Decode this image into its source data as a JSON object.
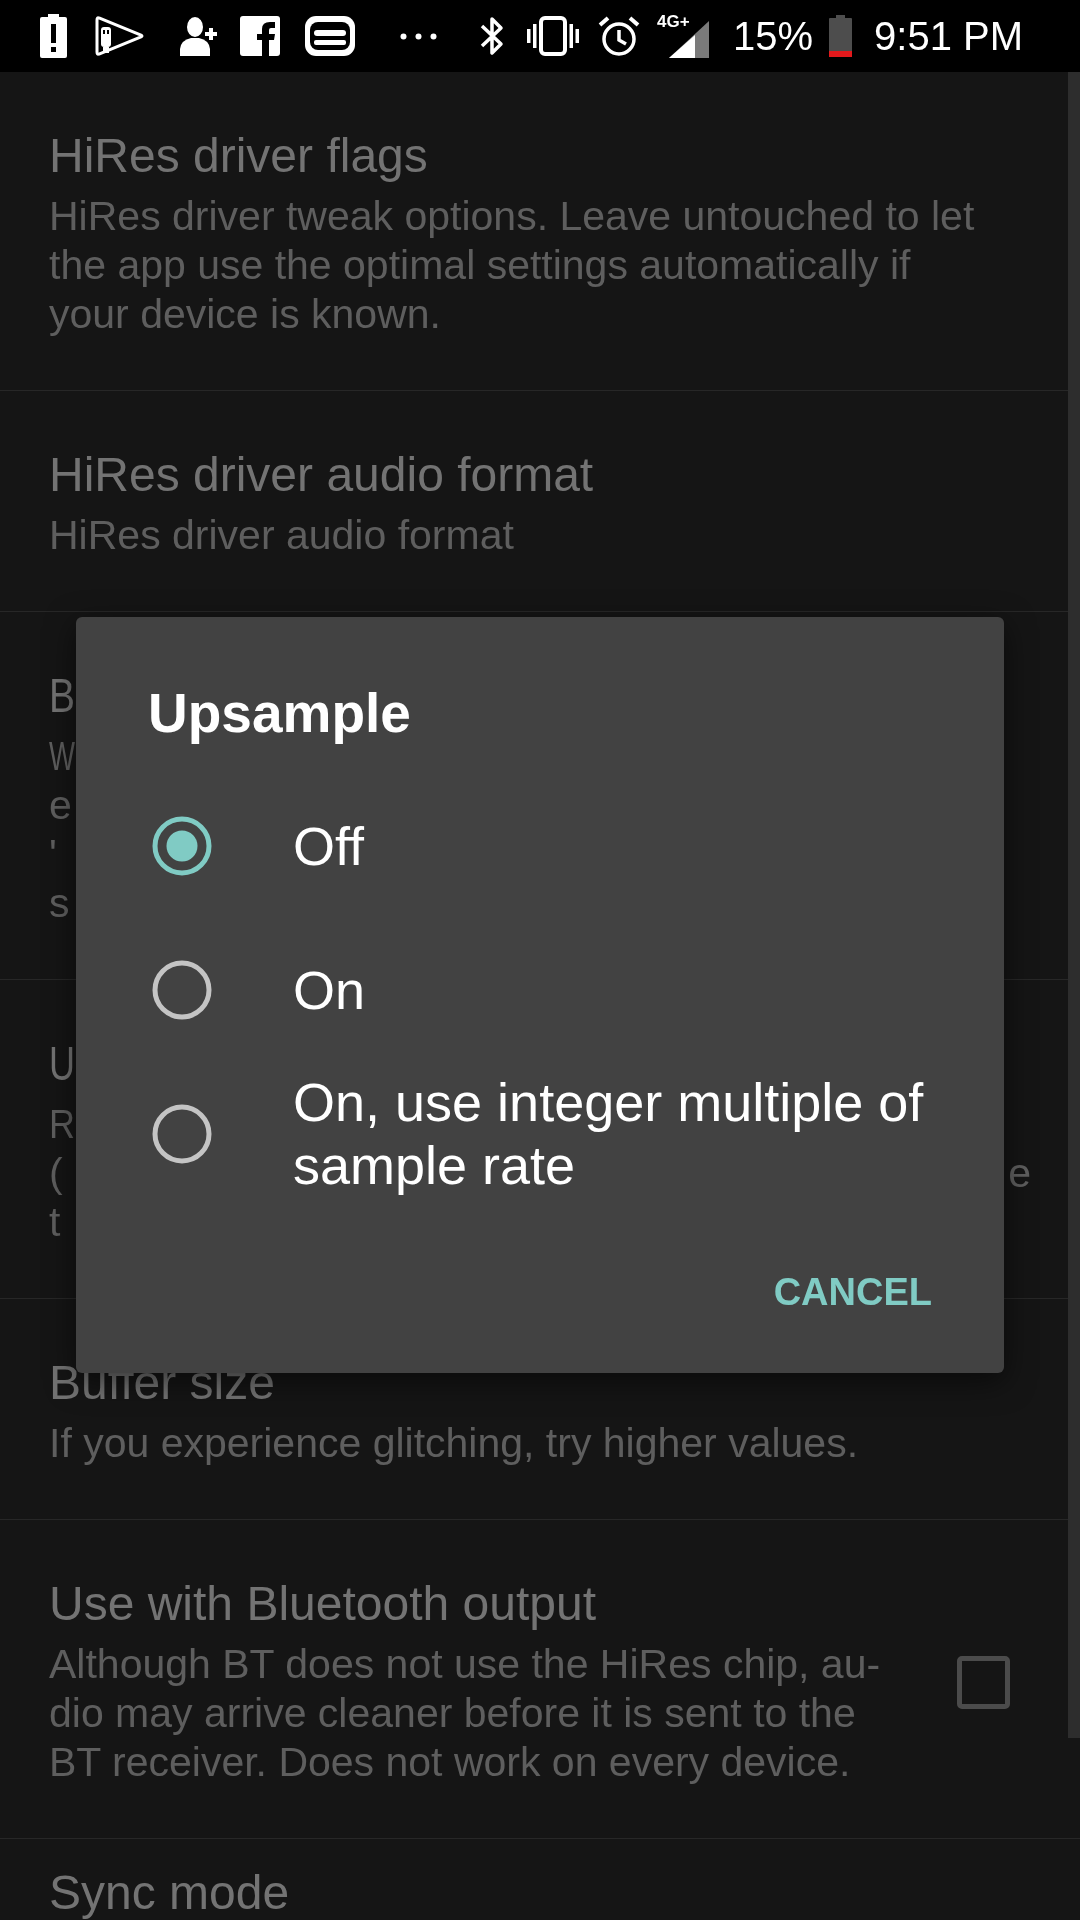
{
  "status_bar": {
    "network_type": "4G+",
    "battery_percent": "15%",
    "time": "9:51 PM"
  },
  "settings": [
    {
      "kind": "text",
      "title": "HiRes driver flags",
      "summary": "HiRes driver tweak options. Leave untouched to let\nthe app use the optimal settings automatically if\nyour device is known."
    },
    {
      "kind": "text",
      "title": "HiRes driver audio format",
      "summary": "HiRes driver audio format"
    },
    {
      "kind": "covered",
      "title": "B",
      "summary_lines": [
        {
          "start": "W"
        },
        {
          "start": "e"
        },
        {
          "start": "'"
        },
        {
          "start": "s"
        }
      ]
    },
    {
      "kind": "covered",
      "title": "U",
      "summary_lines": [
        {
          "start": "R"
        },
        {
          "start": "(",
          "end": "e"
        },
        {
          "start": "t"
        }
      ]
    },
    {
      "kind": "text",
      "title": "Buffer size",
      "summary": "If you experience glitching, try higher values."
    },
    {
      "kind": "checkbox",
      "title": "Use with Bluetooth output",
      "summary": "Although BT does not use the HiRes chip, au-\ndio may arrive cleaner before it is sent to the\nBT receiver. Does not work on every device.",
      "checked": false
    },
    {
      "kind": "text",
      "title": "Sync mode"
    }
  ],
  "dialog": {
    "title": "Upsample",
    "options": [
      {
        "label": "Off",
        "selected": true
      },
      {
        "label": "On",
        "selected": false
      },
      {
        "label": "On, use integer multiple of sample rate",
        "selected": false
      }
    ],
    "buttons": [
      "CANCEL"
    ]
  }
}
